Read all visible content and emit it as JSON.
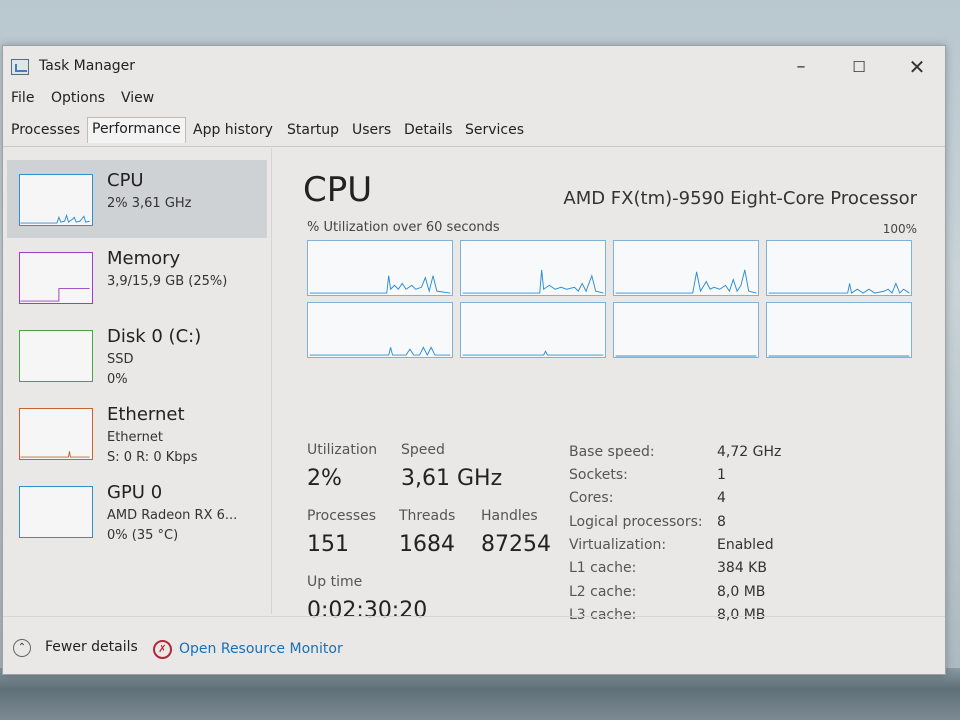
{
  "window": {
    "title": "Task Manager"
  },
  "menu": [
    "File",
    "Options",
    "View"
  ],
  "tabs": [
    "Processes",
    "Performance",
    "App history",
    "Startup",
    "Users",
    "Details",
    "Services"
  ],
  "sidebar": [
    {
      "title": "CPU",
      "sub1": "2% 3,61 GHz",
      "sub2": "",
      "color": "#2f8fd1"
    },
    {
      "title": "Memory",
      "sub1": "3,9/15,9 GB (25%)",
      "sub2": "",
      "color": "#9b3fc4"
    },
    {
      "title": "Disk 0 (C:)",
      "sub1": "SSD",
      "sub2": "0%",
      "color": "#4ca34c"
    },
    {
      "title": "Ethernet",
      "sub1": "Ethernet",
      "sub2": "S: 0 R: 0 Kbps",
      "color": "#c9622a"
    },
    {
      "title": "GPU 0",
      "sub1": "AMD Radeon RX 6...",
      "sub2": "0% (35 °C)",
      "color": "#2f8fd1"
    }
  ],
  "main": {
    "title": "CPU",
    "processor": "AMD FX(tm)-9590 Eight-Core Processor",
    "graph_label": "% Utilization over 60 seconds",
    "graph_max": "100%",
    "stats": {
      "utilization_label": "Utilization",
      "utilization": "2%",
      "speed_label": "Speed",
      "speed": "3,61 GHz",
      "processes_label": "Processes",
      "processes": "151",
      "threads_label": "Threads",
      "threads": "1684",
      "handles_label": "Handles",
      "handles": "87254",
      "uptime_label": "Up time",
      "uptime": "0:02:30:20"
    },
    "specs": [
      {
        "label": "Base speed:",
        "value": "4,72 GHz"
      },
      {
        "label": "Sockets:",
        "value": "1"
      },
      {
        "label": "Cores:",
        "value": "4"
      },
      {
        "label": "Logical processors:",
        "value": "8"
      },
      {
        "label": "Virtualization:",
        "value": "Enabled"
      },
      {
        "label": "L1 cache:",
        "value": "384 KB"
      },
      {
        "label": "L2 cache:",
        "value": "8,0 MB"
      },
      {
        "label": "L3 cache:",
        "value": "8,0 MB"
      }
    ]
  },
  "footer": {
    "fewer_details": "Fewer details",
    "open_monitor": "Open Resource Monitor"
  },
  "accent": "#2f8fd1"
}
